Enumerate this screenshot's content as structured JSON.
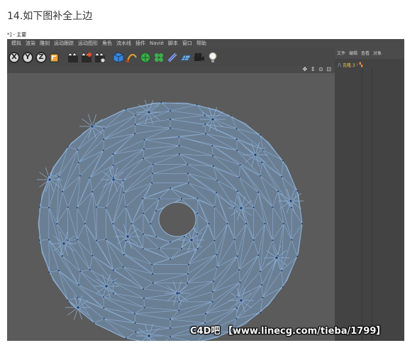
{
  "caption": "14.如下图补全上边",
  "window_title": "*] - 主要",
  "menu": [
    "模拟",
    "渲染",
    "雕刻",
    "运动跟踪",
    "运动图形",
    "角色",
    "流水线",
    "插件",
    "Navié",
    "脚本",
    "窗口",
    "帮助"
  ],
  "toolbar": {
    "axes": [
      "X",
      "Y",
      "Z"
    ],
    "icons": [
      "coordinate-system-icon",
      "render-view-icon",
      "render-picture-queue-icon",
      "render-settings-icon",
      "cube-icon",
      "spline-pen-icon",
      "subdivision-surface-icon",
      "cloner-icon",
      "deformer-icon",
      "floor-icon",
      "camera-icon",
      "light-icon"
    ]
  },
  "viewport": {
    "controls": "✥ ⇕ ⊙ ⊡"
  },
  "right_panel": {
    "menu": [
      "文件",
      "编辑",
      "查看",
      "对象"
    ],
    "object": "克隆.3"
  },
  "watermark": "C4D吧 【www.linecg.com/tieba/1799】",
  "colors": {
    "mesh_fill": "#6b7f94",
    "mesh_edge": "#8fb4dc",
    "mesh_vertex": "#1e3a6e",
    "viewport_bg": "#5b5b5b"
  }
}
